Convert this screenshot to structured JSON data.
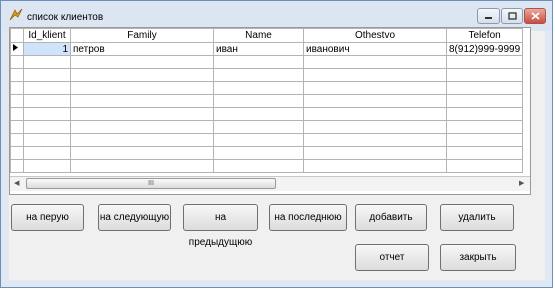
{
  "window": {
    "title": "список клиентов"
  },
  "icons": {
    "app": "app-icon",
    "minimize": "minimize-icon",
    "maximize": "maximize-icon",
    "close": "close-icon"
  },
  "table": {
    "columns": [
      "Id_klient",
      "Family",
      "Name",
      "Othestvo",
      "Telefon"
    ],
    "rows": [
      [
        "1",
        "петров",
        "иван",
        "иванович",
        "8(912)999-9999"
      ]
    ]
  },
  "scrollbar": {
    "thumb_grip": "III"
  },
  "buttons": {
    "first": "на перую",
    "next": "на следующую",
    "prev": "на предыдущюю",
    "last": "на последнюю",
    "add": "добавить",
    "delete": "удалить",
    "report": "отчет",
    "close": "закрыть"
  },
  "colors": {
    "title_bg": "#dce6f2",
    "close_btn": "#c94d3f",
    "selection": "#cfe3fa"
  }
}
